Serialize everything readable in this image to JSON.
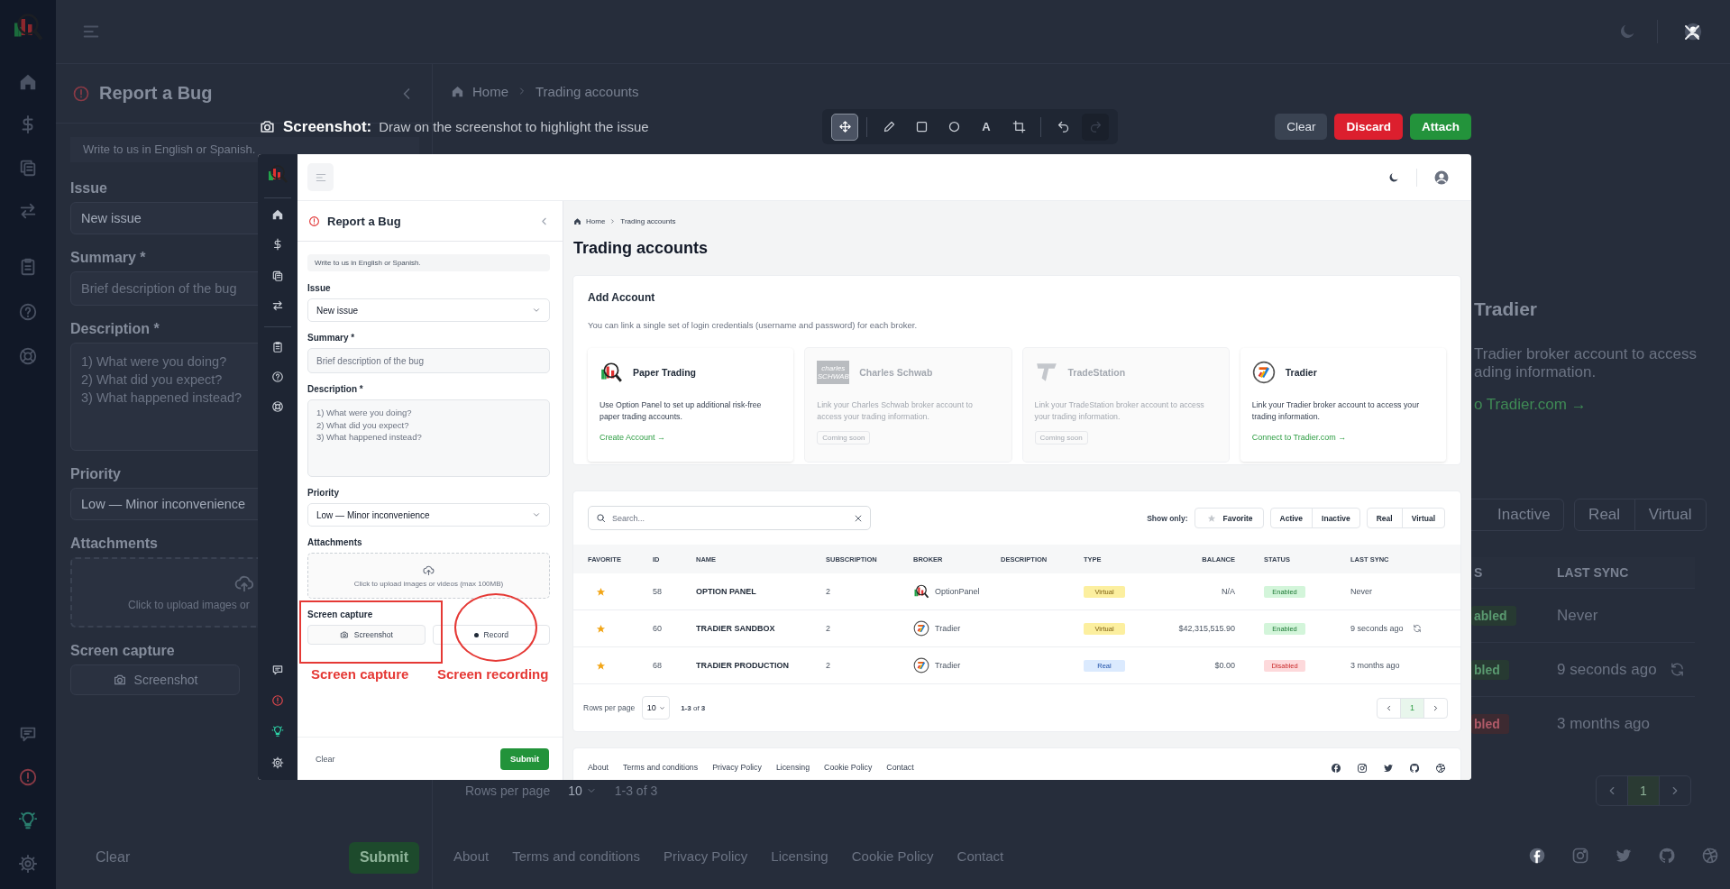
{
  "background": {
    "bug_panel": {
      "title": "Report a Bug",
      "note": "Write to us in English or Spanish.",
      "fields": [
        {
          "kind": "select",
          "label": "Issue",
          "value": "New issue"
        },
        {
          "kind": "input",
          "label": "Summary *",
          "placeholder": "Brief description of the bug"
        },
        {
          "kind": "textarea",
          "label": "Description *",
          "placeholder": "1) What were you doing?\n2) What did you expect?\n3) What happened instead?"
        },
        {
          "kind": "select",
          "label": "Priority",
          "value": "Low — Minor inconvenience"
        },
        {
          "kind": "upload",
          "label": "Attachments",
          "hint": "Click to upload images or"
        }
      ],
      "capture_label": "Screen capture",
      "capture_buttons": [
        {
          "kind": "screenshot",
          "label": "Screenshot"
        }
      ],
      "clear": "Clear",
      "submit": "Submit"
    },
    "breadcrumb": [
      "Home",
      "Trading accounts"
    ],
    "broker_fragment": {
      "name": "Tradier",
      "lines": [
        "Tradier broker account to access",
        "ading information."
      ],
      "link": "o Tradier.com →"
    },
    "filter_groups": [
      [
        {
          "label": "Inactive",
          "selected": false
        }
      ],
      [
        {
          "label": "Real",
          "selected": false
        },
        {
          "label": "Virtual",
          "selected": false
        }
      ]
    ],
    "columns": [
      "S",
      "LAST SYNC"
    ],
    "rows": [
      {
        "status": {
          "label": "abled",
          "kind": "enabled"
        },
        "last_sync": "Never",
        "sync_icon": false
      },
      {
        "status": {
          "label": "bled",
          "kind": "enabled"
        },
        "last_sync": "9 seconds ago",
        "sync_icon": true
      },
      {
        "status": {
          "label": "bled",
          "kind": "disabled"
        },
        "last_sync": "3 months ago",
        "sync_icon": false
      }
    ],
    "rows_per_page": {
      "label": "Rows per page",
      "value": "10",
      "range": "1-3 of 3"
    },
    "pages": [
      {
        "label": "1",
        "selected": true
      }
    ],
    "footer_links": [
      "About",
      "Terms and conditions",
      "Privacy Policy",
      "Licensing",
      "Cookie Policy",
      "Contact"
    ],
    "social": [
      {
        "kind": "facebook"
      },
      {
        "kind": "instagram"
      },
      {
        "kind": "twitter"
      },
      {
        "kind": "github"
      },
      {
        "kind": "dribbble"
      }
    ]
  },
  "editor": {
    "title": "Screenshot:",
    "hint": "Draw on the screenshot to highlight the issue",
    "tools": [
      {
        "kind": "move",
        "selected": true,
        "disabled": false
      },
      {
        "kind": "pen",
        "selected": false,
        "disabled": false
      },
      {
        "kind": "rectangle",
        "selected": false,
        "disabled": false
      },
      {
        "kind": "ellipse",
        "selected": false,
        "disabled": false
      },
      {
        "kind": "text",
        "label": "A",
        "selected": false,
        "disabled": false
      },
      {
        "kind": "crop",
        "selected": false,
        "disabled": false
      },
      {
        "kind": "undo",
        "selected": false,
        "disabled": false
      },
      {
        "kind": "redo",
        "selected": false,
        "disabled": true
      }
    ],
    "actions": [
      {
        "kind": "neutral",
        "label": "Clear"
      },
      {
        "kind": "danger",
        "label": "Discard"
      },
      {
        "kind": "primary",
        "label": "Attach"
      }
    ]
  },
  "capture": {
    "bug_panel": {
      "title": "Report a Bug",
      "note": "Write to us in English or Spanish.",
      "fields": [
        {
          "kind": "select",
          "label": "Issue",
          "value": "New issue"
        },
        {
          "kind": "input",
          "label": "Summary *",
          "placeholder": "Brief description of the bug"
        },
        {
          "kind": "textarea",
          "label": "Description *",
          "placeholder": "1) What were you doing?\n2) What did you expect?\n3) What happened instead?"
        },
        {
          "kind": "select",
          "label": "Priority",
          "value": "Low — Minor inconvenience"
        },
        {
          "kind": "upload",
          "label": "Attachments",
          "hint": "Click to upload images or videos (max 100MB)"
        }
      ],
      "capture_label": "Screen capture",
      "capture_buttons": [
        {
          "kind": "screenshot",
          "label": "Screenshot"
        },
        {
          "kind": "record",
          "label": "Record"
        }
      ],
      "clear": "Clear",
      "submit": "Submit"
    },
    "breadcrumb": [
      "Home",
      "Trading accounts"
    ],
    "title": "Trading accounts",
    "add_account": {
      "title": "Add Account",
      "description": "You can link a single set of login credentials (username and password) for each broker.",
      "providers": [
        {
          "kind": "optionpanel",
          "name": "Paper Trading",
          "description": "Use Option Panel to set up additional risk-free paper trading accounts.",
          "disabled": false,
          "link": "Create Account →"
        },
        {
          "kind": "schwab",
          "logo_text": "charles SCHWAB",
          "name": "Charles Schwab",
          "description": "Link your Charles Schwab broker account to access your trading information.",
          "disabled": true,
          "badge": "Coming soon"
        },
        {
          "kind": "tradestation",
          "name": "TradeStation",
          "description": "Link your TradeStation broker account to access your trading information.",
          "disabled": true,
          "badge": "Coming soon"
        },
        {
          "kind": "tradier",
          "name": "Tradier",
          "description": "Link your Tradier broker account to access your trading information.",
          "disabled": false,
          "link": "Connect to Tradier.com →"
        }
      ]
    },
    "search": {
      "placeholder": "Search..."
    },
    "show_only": "Show only:",
    "filter_groups": [
      [
        {
          "label": "Favorite",
          "selected": false
        }
      ],
      [
        {
          "label": "Active",
          "selected": false
        },
        {
          "label": "Inactive",
          "selected": false
        }
      ],
      [
        {
          "label": "Real",
          "selected": false
        },
        {
          "label": "Virtual",
          "selected": false
        }
      ]
    ],
    "columns": [
      "FAVORITE",
      "ID",
      "NAME",
      "SUBSCRIPTION",
      "BROKER",
      "DESCRIPTION",
      "TYPE",
      "BALANCE",
      "STATUS",
      "LAST SYNC"
    ],
    "accounts": [
      {
        "favorite": true,
        "id": "58",
        "name": "OPTION PANEL",
        "subscription": "2",
        "broker": {
          "label": "OptionPanel",
          "kind": "optionpanel"
        },
        "type": {
          "label": "Virtual",
          "kind": "virtual"
        },
        "balance": "N/A",
        "status": {
          "label": "Enabled",
          "kind": "enabled"
        },
        "last_sync": "Never",
        "sync_icon": false
      },
      {
        "favorite": true,
        "id": "60",
        "name": "TRADIER SANDBOX",
        "subscription": "2",
        "broker": {
          "label": "Tradier",
          "kind": "tradier"
        },
        "type": {
          "label": "Virtual",
          "kind": "virtual"
        },
        "balance": "$42,315,515.90",
        "status": {
          "label": "Enabled",
          "kind": "enabled"
        },
        "last_sync": "9 seconds ago",
        "sync_icon": true
      },
      {
        "favorite": true,
        "id": "68",
        "name": "TRADIER PRODUCTION",
        "subscription": "2",
        "broker": {
          "label": "Tradier",
          "kind": "tradier"
        },
        "type": {
          "label": "Real",
          "kind": "real"
        },
        "balance": "$0.00",
        "status": {
          "label": "Disabled",
          "kind": "disabled"
        },
        "last_sync": "3 months ago",
        "sync_icon": false
      }
    ],
    "rows_per_page": {
      "label": "Rows per page",
      "value": "10",
      "range": "**1-3** of **3**"
    },
    "pages": [
      {
        "label": "1",
        "selected": true
      }
    ],
    "footer_links": [
      "About",
      "Terms and conditions",
      "Privacy Policy",
      "Licensing",
      "Cookie Policy",
      "Contact"
    ],
    "social": [
      {
        "kind": "facebook"
      },
      {
        "kind": "instagram"
      },
      {
        "kind": "twitter"
      },
      {
        "kind": "github"
      },
      {
        "kind": "dribbble"
      }
    ],
    "annotations": [
      {
        "kind": "rectangle"
      },
      {
        "kind": "ellipse"
      },
      {
        "kind": "label",
        "text": "Screen capture"
      },
      {
        "kind": "label",
        "text": "Screen recording"
      }
    ]
  }
}
